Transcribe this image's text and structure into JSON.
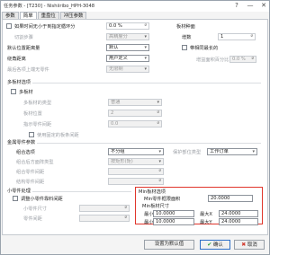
{
  "window": {
    "title": "任务参数 - [T230] - Nishiiribo_HPH-3048",
    "help_glyph": "?",
    "minimize_glyph": "—",
    "close_glyph": "✕"
  },
  "tabs": [
    "参数",
    "简单",
    "重盘位",
    "冲压参数"
  ],
  "left_top": {
    "add_mark_label": "如果时间无小于到指定循环分",
    "mark_value": "0.0 %",
    "mark_kind_label": "切割步骤",
    "mark_kind_value": "高精度分",
    "default_spacing_label": "默认位置距离量",
    "default_spacing_value": "默认",
    "rotate_angle_label": "绕角距离",
    "rotate_angle_value": "用户定义",
    "max_spacing_label": "最后各项上端无零件",
    "max_spacing_value": "无限制"
  },
  "right_top": {
    "section_title": "板材种面",
    "count_label": "增数",
    "count_value": "1",
    "same_label": "带相同最长的",
    "ratio_label": "增益面积百分比",
    "ratio_value": "0.0 %"
  },
  "multi": {
    "title": "多板材选项",
    "checkbox_label": "多板材",
    "kind_label": "多板材的类型",
    "kind_value": "普通",
    "count_label": "板材位置",
    "count_value": "2",
    "spacing_label": "指示零件间距",
    "spacing_value": "0.0",
    "use_label": "使用固定的板条间距"
  },
  "trim": {
    "title": "金属零件参数",
    "combo_label": "组合选项",
    "combo_value": "不分组",
    "pattern_label": "组合后方面阵类型",
    "pattern_value": "按矩形(矩)",
    "spacing_label": "组合零件间距",
    "margin_label": "结构零件间距",
    "sort_label": "保护部位类型",
    "sort_value": "工作订单"
  },
  "small": {
    "title": "小零件处理",
    "checkbox_label": "调整小零件靠料间距",
    "size_label": "小零件尺寸",
    "gap_label": "零件间距"
  },
  "min_sheet": {
    "title": "Min板材选项",
    "area_label": "Min零件框限面积",
    "area_value": "20.0000",
    "size_label": "Min板材尺寸",
    "minx_label": "最小X",
    "minx_value": "10.0000",
    "maxx_label": "最大X",
    "maxx_value": "24.0000",
    "miny_label": "最小Y",
    "miny_value": "10.0000",
    "maxy_label": "最大Y",
    "maxy_value": "24.0000"
  },
  "buttons": {
    "default_label": "设置为默认值",
    "ok_icon": "✔",
    "ok_label": "确认",
    "cancel_icon": "✖",
    "cancel_label": "取消"
  }
}
